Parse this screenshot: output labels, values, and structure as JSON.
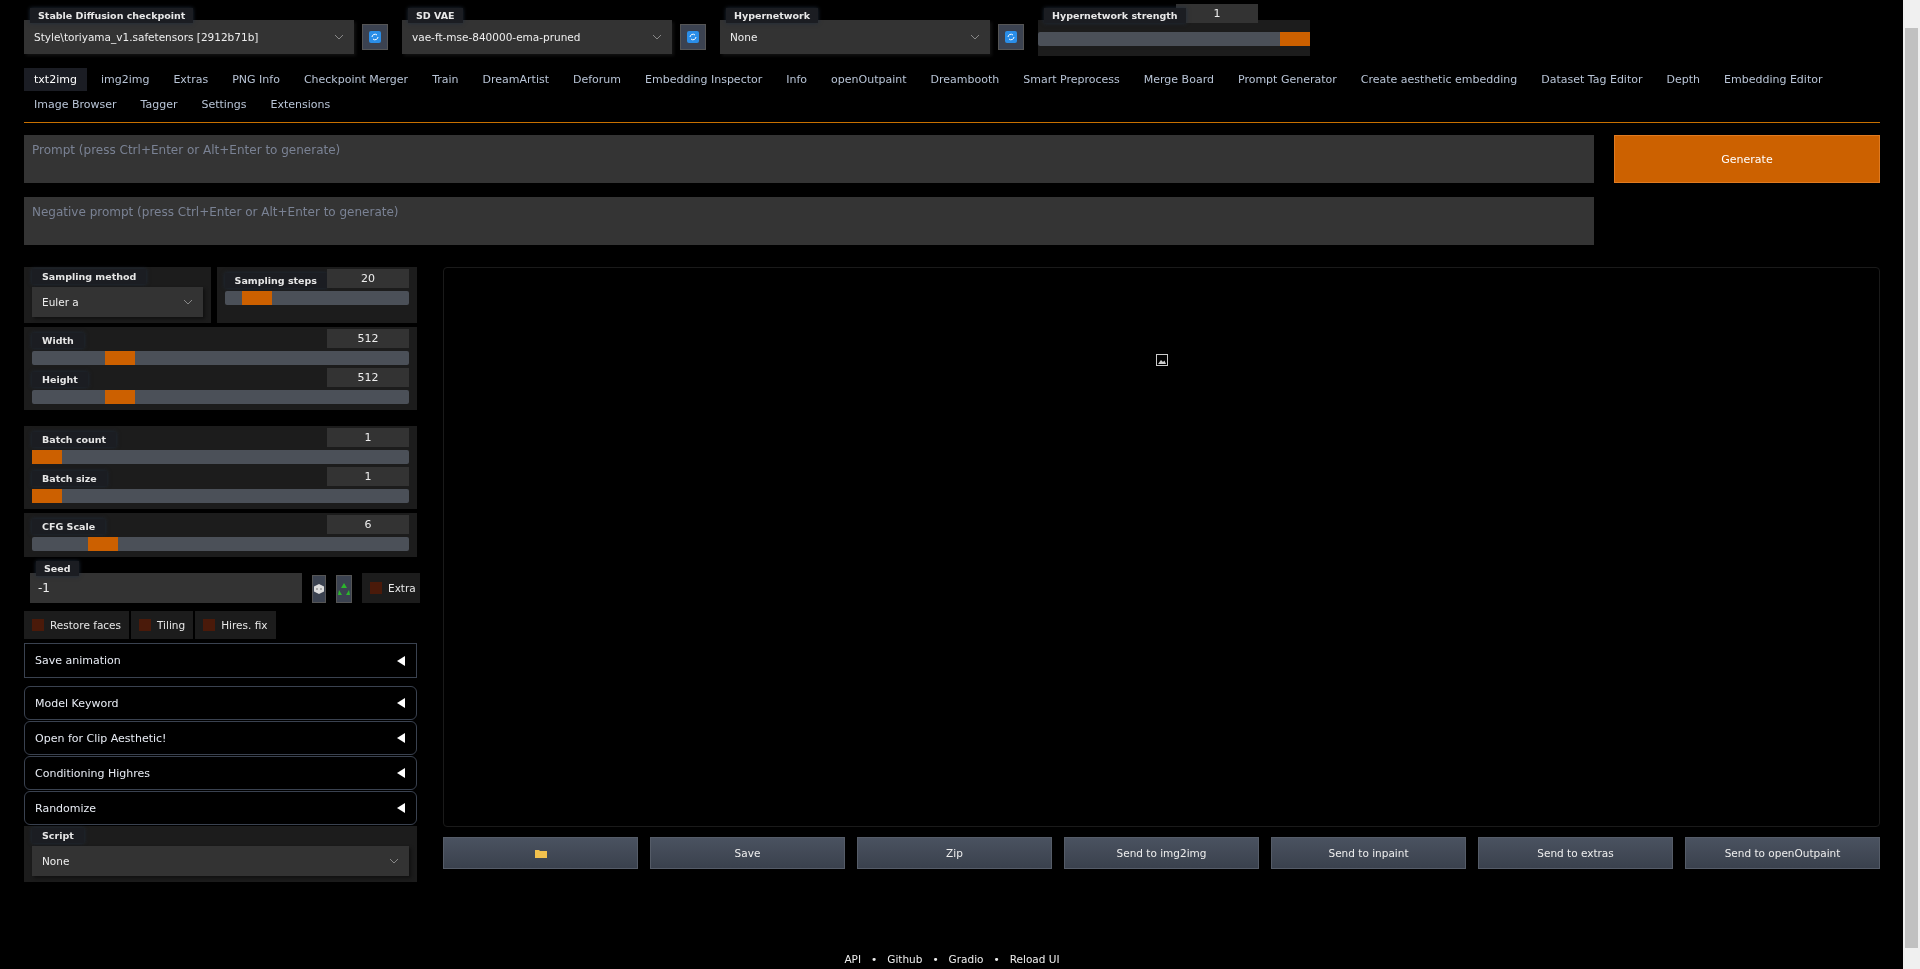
{
  "top_settings": [
    {
      "kind": "dropdown",
      "label": "Stable Diffusion checkpoint",
      "value": "Style\\toriyama_v1.safetensors [2912b71b]"
    },
    {
      "kind": "dropdown",
      "label": "SD VAE",
      "value": "vae-ft-mse-840000-ema-pruned"
    },
    {
      "kind": "dropdown",
      "label": "Hypernetwork",
      "value": "None"
    },
    {
      "kind": "slider",
      "label": "Hypernetwork strength",
      "value": "1",
      "level": 1
    }
  ],
  "tabs": [
    {
      "label": "txt2img",
      "selected": true
    },
    {
      "label": "img2img",
      "selected": false
    },
    {
      "label": "Extras",
      "selected": false
    },
    {
      "label": "PNG Info",
      "selected": false
    },
    {
      "label": "Checkpoint Merger",
      "selected": false
    },
    {
      "label": "Train",
      "selected": false
    },
    {
      "label": "DreamArtist",
      "selected": false
    },
    {
      "label": "Deforum",
      "selected": false
    },
    {
      "label": "Embedding Inspector",
      "selected": false
    },
    {
      "label": "Info",
      "selected": false
    },
    {
      "label": "openOutpaint",
      "selected": false
    },
    {
      "label": "Dreambooth",
      "selected": false
    },
    {
      "label": "Smart Preprocess",
      "selected": false
    },
    {
      "label": "Merge Board",
      "selected": false
    },
    {
      "label": "Prompt Generator",
      "selected": false
    },
    {
      "label": "Create aesthetic embedding",
      "selected": false
    },
    {
      "label": "Dataset Tag Editor",
      "selected": false
    },
    {
      "label": "Depth",
      "selected": false
    },
    {
      "label": "Embedding Editor",
      "selected": false
    },
    {
      "label": "Image Browser",
      "selected": false
    },
    {
      "label": "Tagger",
      "selected": false
    },
    {
      "label": "Settings",
      "selected": false
    },
    {
      "label": "Extensions",
      "selected": false
    }
  ],
  "prompt": {
    "placeholder": "Prompt (press Ctrl+Enter or Alt+Enter to generate)"
  },
  "negative_prompt": {
    "placeholder": "Negative prompt (press Ctrl+Enter or Alt+Enter to generate)"
  },
  "generate_button": "Generate",
  "sampling_method": {
    "label": "Sampling method",
    "value": "Euler a"
  },
  "sampling_steps": {
    "label": "Sampling steps",
    "value": "20",
    "level": 0.11
  },
  "size_sliders": [
    {
      "label": "Width",
      "value": "512",
      "level": 0.21
    },
    {
      "label": "Height",
      "value": "512",
      "level": 0.21
    }
  ],
  "batch_sliders": [
    {
      "label": "Batch count",
      "value": "1",
      "level": 0
    },
    {
      "label": "Batch size",
      "value": "1",
      "level": 0
    }
  ],
  "cfg_scale": {
    "label": "CFG Scale",
    "value": "6",
    "level": 0.16
  },
  "seed": {
    "label": "Seed",
    "value": "-1",
    "extra": {
      "label": "Extra",
      "checked": false
    }
  },
  "options": [
    {
      "label": "Restore faces",
      "checked": false
    },
    {
      "label": "Tiling",
      "checked": false
    },
    {
      "label": "Hires. fix",
      "checked": false
    }
  ],
  "accordions": [
    {
      "label": "Save animation",
      "expanded": false,
      "kind": "square"
    },
    {
      "label": "Model Keyword",
      "expanded": false,
      "kind": "rounded"
    },
    {
      "label": "Open for Clip Aesthetic!",
      "expanded": false,
      "kind": "rounded"
    },
    {
      "label": "Conditioning Highres",
      "expanded": false,
      "kind": "rounded"
    },
    {
      "label": "Randomize",
      "expanded": false,
      "kind": "rounded"
    }
  ],
  "script": {
    "label": "Script",
    "value": "None"
  },
  "output_buttons": [
    {
      "kind": "folder"
    },
    {
      "kind": "text",
      "label": "Save"
    },
    {
      "kind": "text",
      "label": "Zip"
    },
    {
      "kind": "text",
      "label": "Send to img2img"
    },
    {
      "kind": "text",
      "label": "Send to inpaint"
    },
    {
      "kind": "text",
      "label": "Send to extras"
    },
    {
      "kind": "text",
      "label": "Send to openOutpaint"
    }
  ],
  "footer_links": [
    "API",
    "Github",
    "Gradio",
    "Reload UI"
  ],
  "footer_separator": "•"
}
